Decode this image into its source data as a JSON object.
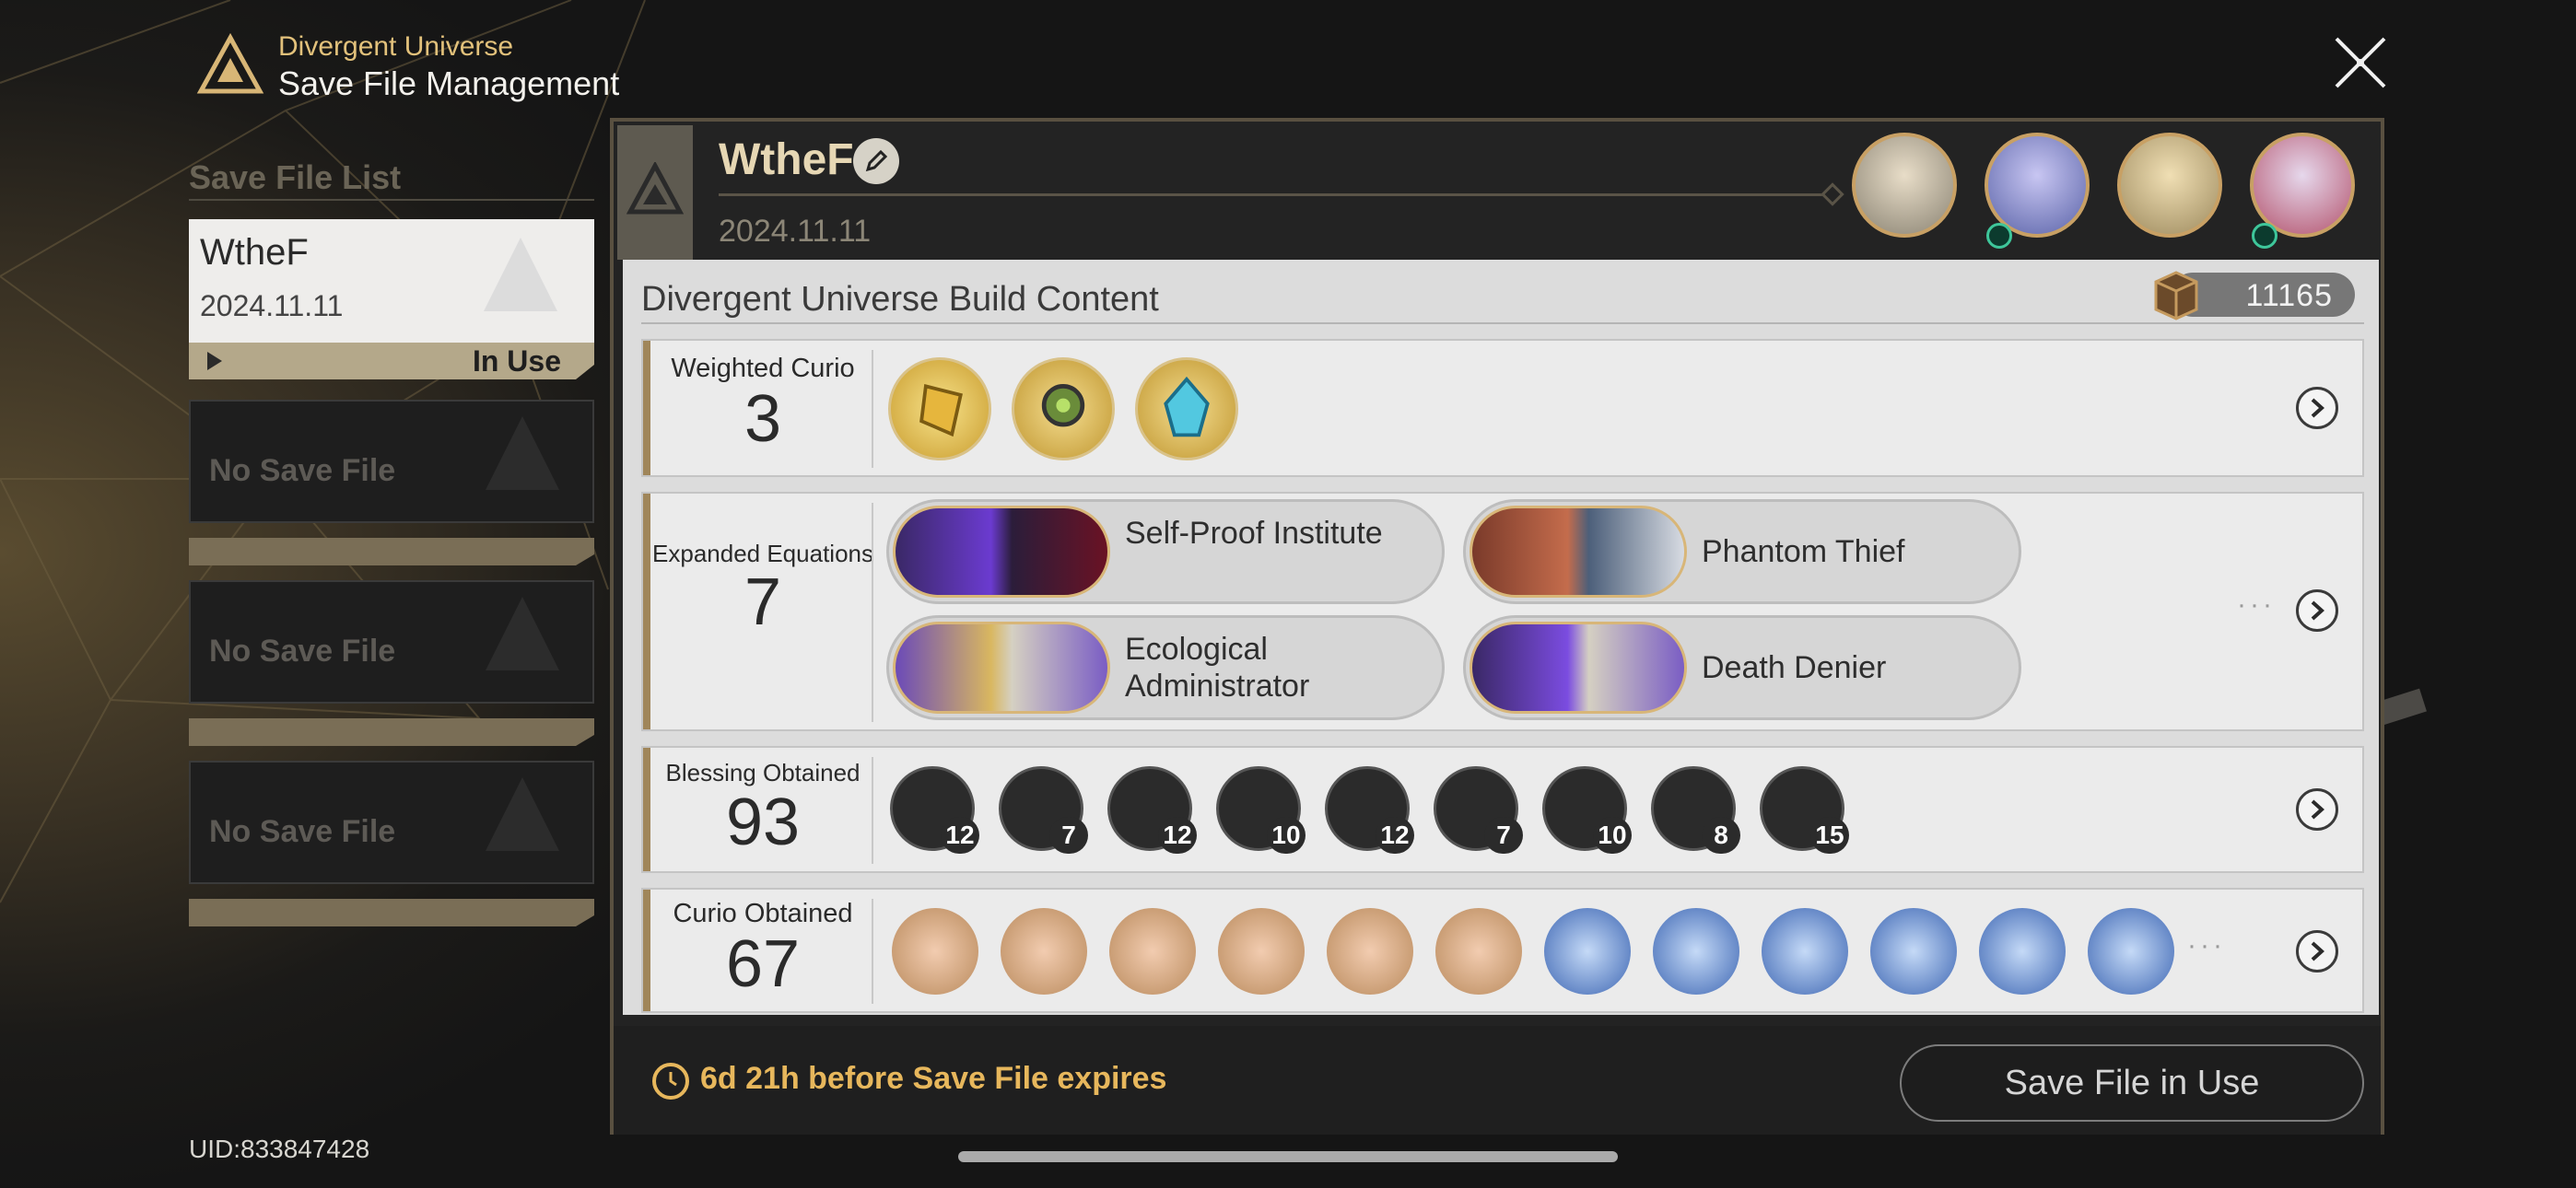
{
  "header": {
    "subtitle": "Divergent Universe",
    "title": "Save File Management",
    "close_icon": "close-icon"
  },
  "save_list": {
    "label": "Save File List",
    "slots": [
      {
        "name": "WtheF",
        "date": "2024.11.11",
        "status": "In Use"
      },
      {
        "empty_text": "No Save File"
      },
      {
        "empty_text": "No Save File"
      },
      {
        "empty_text": "No Save File"
      }
    ]
  },
  "uid": "UID:833847428",
  "panel": {
    "name": "WtheF",
    "date": "2024.11.11",
    "content_title": "Divergent Universe Build Content",
    "score": "11165",
    "weighted_curio": {
      "label": "Weighted Curio",
      "count": "3"
    },
    "expanded_equations": {
      "label": "Expanded Equations",
      "count": "7",
      "items": [
        {
          "name": "Self-Proof Institute"
        },
        {
          "name": "Phantom Thief"
        },
        {
          "name": "Ecological Administrator"
        },
        {
          "name": "Death Denier"
        }
      ]
    },
    "blessings": {
      "label": "Blessing Obtained",
      "count": "93",
      "items": [
        {
          "count": "12"
        },
        {
          "count": "7"
        },
        {
          "count": "12"
        },
        {
          "count": "10"
        },
        {
          "count": "12"
        },
        {
          "count": "7"
        },
        {
          "count": "10"
        },
        {
          "count": "8"
        },
        {
          "count": "15"
        }
      ]
    },
    "curio_obtained": {
      "label": "Curio Obtained",
      "count": "67"
    }
  },
  "footer": {
    "expire_text": "6d 21h  before Save File expires",
    "button": "Save File in Use"
  },
  "colors": {
    "accent_gold": "#e7b75c",
    "header_gold": "#e2c17b",
    "frame": "#595040"
  }
}
